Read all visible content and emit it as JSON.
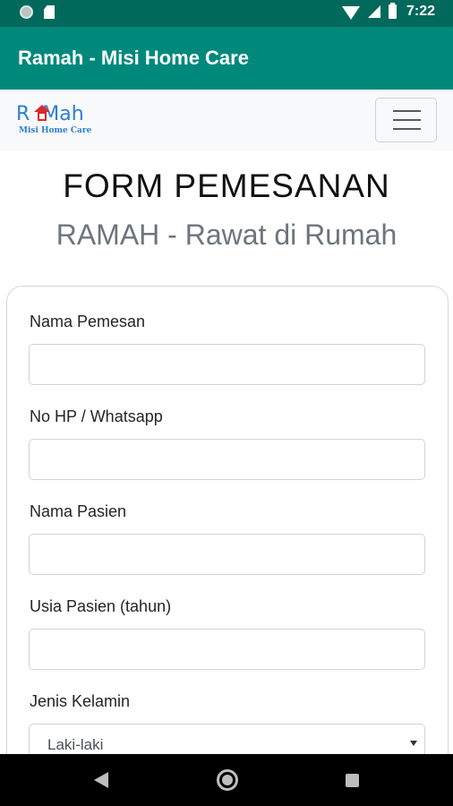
{
  "status_bar": {
    "time": "7:22",
    "icons": [
      "notification-dot-icon",
      "sd-card-icon",
      "wifi-icon",
      "cell-signal-icon",
      "battery-icon"
    ]
  },
  "app_bar": {
    "title": "Ramah - Misi Home Care",
    "color": "#00897b"
  },
  "navbar": {
    "logo": {
      "text": "RuMah",
      "subtitle": "Misi Home Care"
    },
    "menu_icon": "hamburger-icon"
  },
  "form": {
    "title": "FORM PEMESANAN",
    "subtitle": "RAMAH - Rawat di Rumah",
    "fields": [
      {
        "label": "Nama Pemesan",
        "value": ""
      },
      {
        "label": "No HP / Whatsapp",
        "value": ""
      },
      {
        "label": "Nama Pasien",
        "value": ""
      },
      {
        "label": "Usia Pasien (tahun)",
        "value": ""
      }
    ],
    "gender": {
      "label": "Jenis Kelamin",
      "selected": "Laki-laki"
    }
  },
  "system_nav": {
    "icons": [
      "back-icon",
      "home-icon",
      "recent-apps-icon"
    ]
  }
}
